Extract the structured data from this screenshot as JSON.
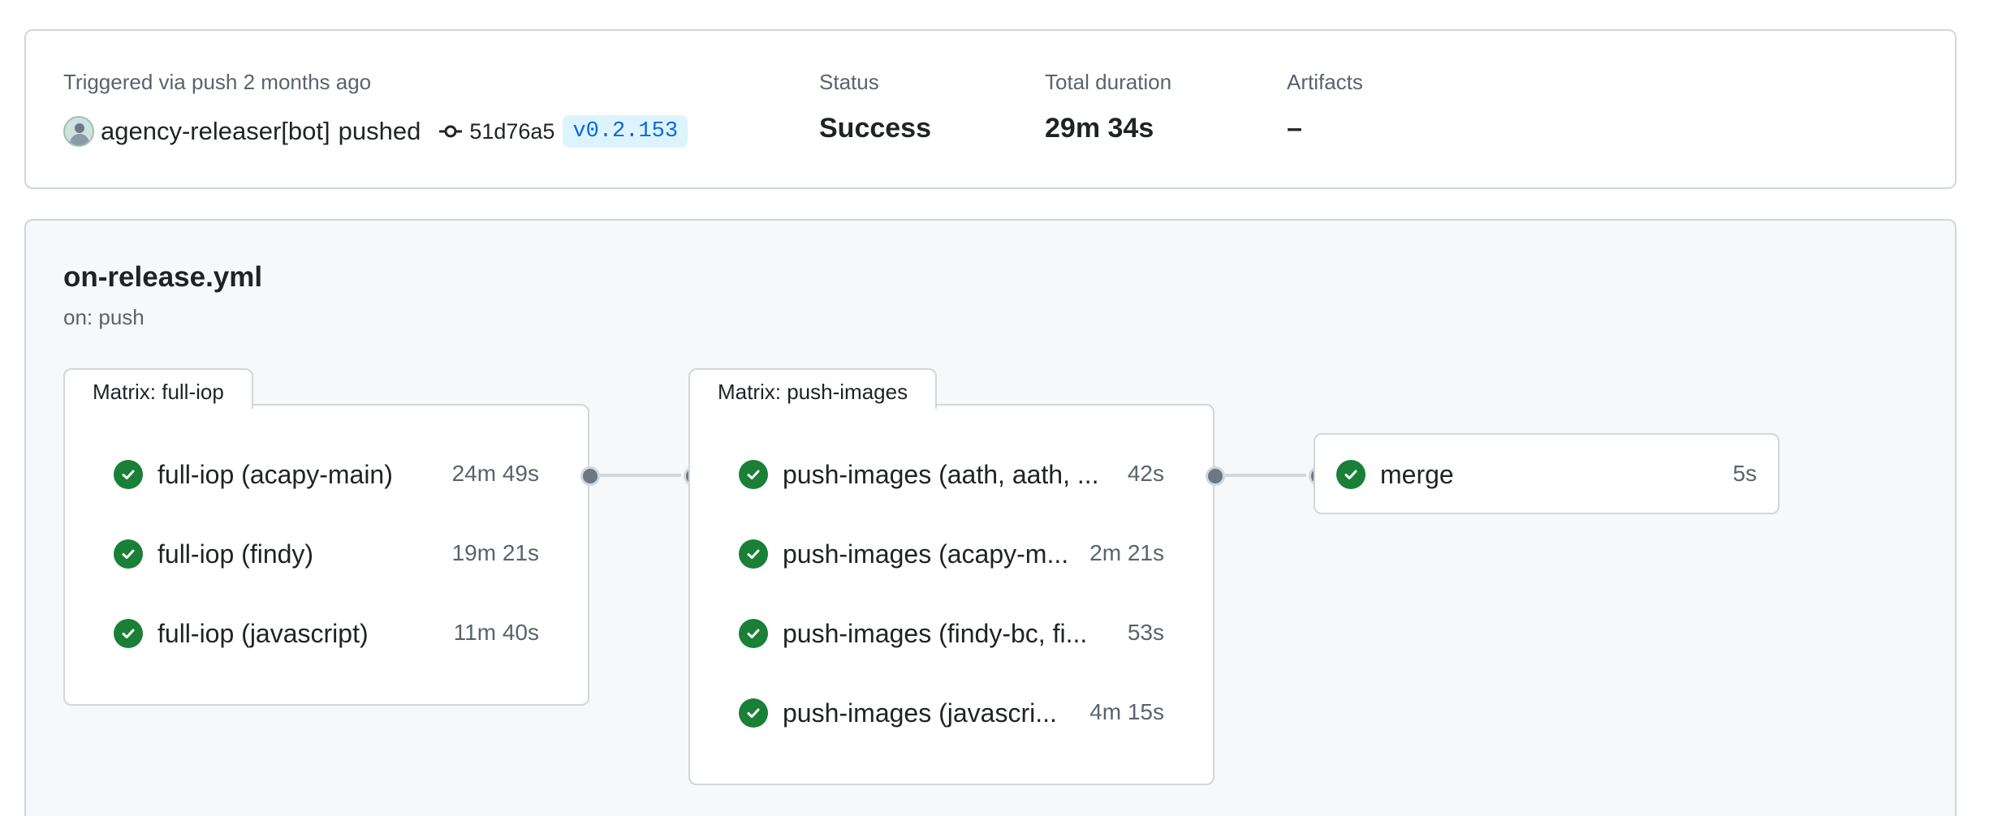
{
  "summary": {
    "trigger_text": "Triggered via push 2 months ago",
    "actor": "agency-releaser[bot]",
    "action": "pushed",
    "commit_sha": "51d76a5",
    "tag": "v0.2.153",
    "status_label": "Status",
    "status_value": "Success",
    "duration_label": "Total duration",
    "duration_value": "29m 34s",
    "artifacts_label": "Artifacts",
    "artifacts_value": "–"
  },
  "workflow": {
    "file": "on-release.yml",
    "trigger": "on: push",
    "matrices": [
      {
        "title": "Matrix: full-iop",
        "jobs": [
          {
            "name": "full-iop (acapy-main)",
            "duration": "24m 49s"
          },
          {
            "name": "full-iop (findy)",
            "duration": "19m 21s"
          },
          {
            "name": "full-iop (javascript)",
            "duration": "11m 40s"
          }
        ]
      },
      {
        "title": "Matrix: push-images",
        "jobs": [
          {
            "name": "push-images (aath, aath, ...",
            "duration": "42s"
          },
          {
            "name": "push-images (acapy-m...",
            "duration": "2m 21s"
          },
          {
            "name": "push-images (findy-bc, fi...",
            "duration": "53s"
          },
          {
            "name": "push-images (javascri...",
            "duration": "4m 15s"
          }
        ]
      }
    ],
    "merge_job": {
      "name": "merge",
      "duration": "5s"
    }
  },
  "colors": {
    "success": "#1a7f37",
    "tag_bg": "#ddf4ff",
    "tag_text": "#0969da",
    "border": "#d0d7de"
  },
  "icons": {
    "check": "check-circle-icon",
    "commit": "git-commit-icon",
    "avatar": "bot-avatar"
  }
}
